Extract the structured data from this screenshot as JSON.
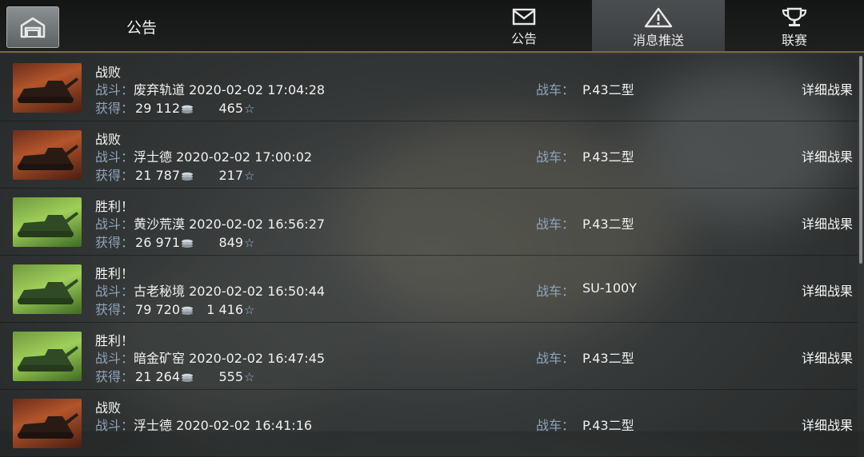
{
  "header": {
    "title": "公告",
    "tabs": [
      {
        "label": "公告",
        "icon": "envelope-icon",
        "active": false
      },
      {
        "label": "消息推送",
        "icon": "warning-triangle-icon",
        "active": true
      },
      {
        "label": "联赛",
        "icon": "trophy-icon",
        "active": false
      }
    ]
  },
  "labels": {
    "battle": "战斗：",
    "earned": "获得：",
    "tank": "战车：",
    "detail": "详细战果"
  },
  "battles": [
    {
      "result": "战败",
      "outcome": "defeat",
      "map": "废弃轨道",
      "datetime": "2020-02-02 17:04:28",
      "credits": "29 112",
      "xp": "465",
      "tank": "P.43二型"
    },
    {
      "result": "战败",
      "outcome": "defeat",
      "map": "浮士德",
      "datetime": "2020-02-02 17:00:02",
      "credits": "21 787",
      "xp": "217",
      "tank": "P.43二型"
    },
    {
      "result": "胜利！",
      "outcome": "victory",
      "map": "黄沙荒漠",
      "datetime": "2020-02-02 16:56:27",
      "credits": "26 971",
      "xp": "849",
      "tank": "P.43二型"
    },
    {
      "result": "胜利！",
      "outcome": "victory",
      "map": "古老秘境",
      "datetime": "2020-02-02 16:50:44",
      "credits": "79 720",
      "xp": "1 416",
      "tank": "SU-100Y"
    },
    {
      "result": "胜利！",
      "outcome": "victory",
      "map": "暗金矿窑",
      "datetime": "2020-02-02 16:47:45",
      "credits": "21 264",
      "xp": "555",
      "tank": "P.43二型"
    },
    {
      "result": "战败",
      "outcome": "defeat",
      "map": "浮士德",
      "datetime": "2020-02-02 16:41:16",
      "credits": "",
      "xp": "",
      "tank": "P.43二型"
    }
  ],
  "colors": {
    "accent_border": "#7a6a4a",
    "label_blue": "#8fa3b8"
  }
}
